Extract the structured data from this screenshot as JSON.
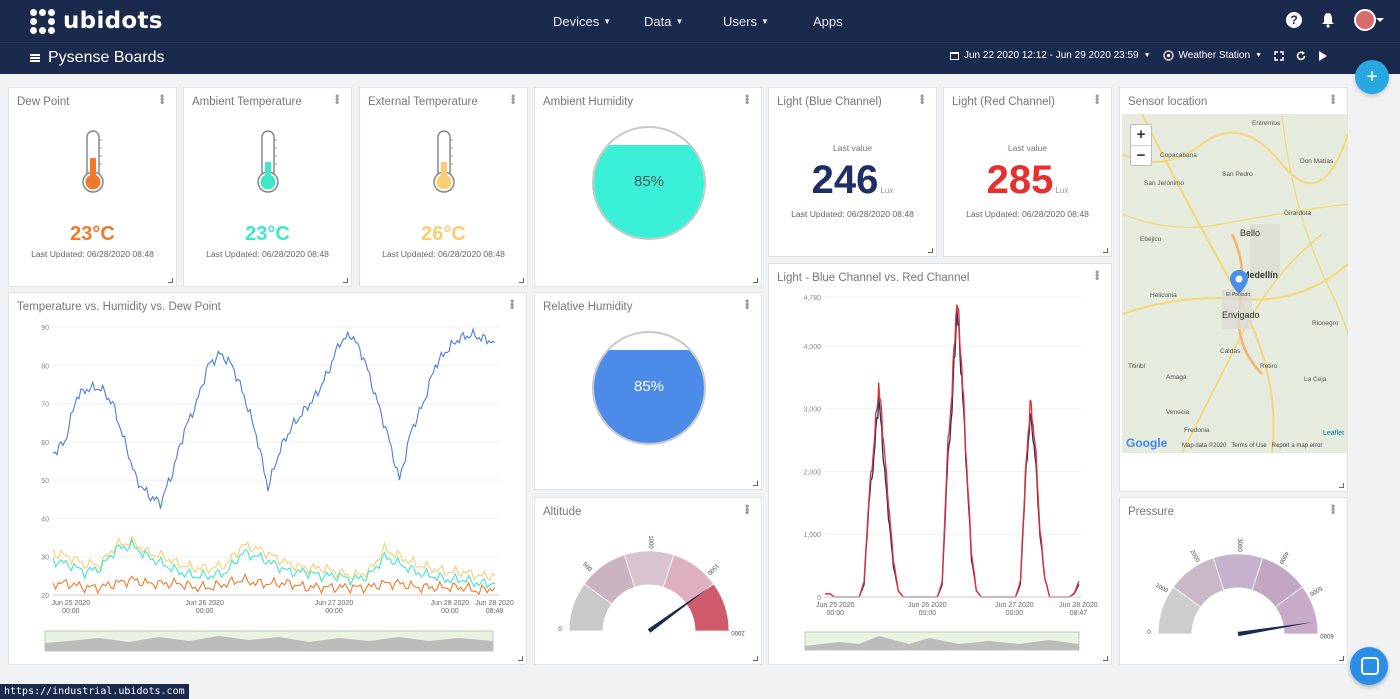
{
  "app": {
    "brand": "ubidots"
  },
  "nav": [
    {
      "label": "Devices",
      "caret": true
    },
    {
      "label": "Data",
      "caret": true
    },
    {
      "label": "Users",
      "caret": true
    },
    {
      "label": "Apps",
      "caret": false
    }
  ],
  "top_icons": [
    "help-icon",
    "bell-icon",
    "avatar"
  ],
  "board": {
    "title": "Pysense Boards"
  },
  "controls": {
    "date_range": "Jun 22 2020 12:12 - Jun 29 2020 23:59",
    "device": "Weather Station"
  },
  "fab_label": "+",
  "widgets": {
    "dew_point": {
      "title": "Dew Point",
      "value": "23°C",
      "updated": "Last Updated: 06/28/2020 08:48",
      "color": "#f07a2b",
      "level": 0.55
    },
    "ambient_temp": {
      "title": "Ambient Temperature",
      "value": "23°C",
      "updated": "Last Updated: 06/28/2020 08:48",
      "color": "#3fe6c8",
      "level": 0.3
    },
    "external_temp": {
      "title": "External Temperature",
      "value": "26°C",
      "updated": "Last Updated: 06/28/2020 08:48",
      "color": "#f9cd74",
      "level": 0.3
    },
    "ambient_humidity": {
      "title": "Ambient Humidity",
      "value": "85%",
      "level": 0.85,
      "color": "#3af0d6"
    },
    "relative_humidity": {
      "title": "Relative Humidity",
      "value": "85%",
      "level": 0.85,
      "color": "#4c8be8"
    },
    "light_blue": {
      "title": "Light (Blue Channel)",
      "label": "Last value",
      "value": "246",
      "unit": "Lux",
      "updated": "Last Updated: 06/28/2020 08:48",
      "color": "#1e2f66"
    },
    "light_red": {
      "title": "Light (Red Channel)",
      "label": "Last value",
      "value": "285",
      "unit": "Lux",
      "updated": "Last Updated: 06/28/2020 08:48",
      "color": "#e82f2f"
    },
    "sensor_location": {
      "title": "Sensor location",
      "zoom_in": "+",
      "zoom_out": "−",
      "places": [
        "Entrerrios",
        "Copacabana",
        "San Jerónimo",
        "San Pedro",
        "Don Matías",
        "Girardota",
        "Ebéjico",
        "Bello",
        "Medellín",
        "Heliconia",
        "Envigado",
        "Rionegro",
        "Caldas",
        "Amagá",
        "Retiro",
        "Titiribí",
        "La Ceja",
        "Venecia",
        "Fredonia",
        "El Poblado"
      ],
      "attribution": "Map data ©2020   Terms of Use   Report a map error",
      "google": "Google",
      "leaflet": "Leaflet"
    },
    "temp_chart": {
      "title": "Temperature vs. Humidity vs. Dew Point"
    },
    "light_chart": {
      "title": "Light - Blue Channel vs. Red Channel"
    },
    "altitude": {
      "title": "Altitude",
      "min": 0,
      "max": 2000,
      "ticks": [
        "0",
        "500",
        "1000",
        "1500",
        "2000"
      ],
      "value": 1600
    },
    "pressure": {
      "title": "Pressure",
      "min": 0,
      "max": 6000,
      "ticks": [
        "0",
        "1000",
        "2000",
        "3000",
        "4000",
        "5000",
        "6000"
      ],
      "value": 5700
    }
  },
  "chart_data": [
    {
      "type": "line",
      "name": "temp_chart",
      "x_ticks": [
        "Jun 25 2020\n00:00",
        "Jun 26 2020\n00:00",
        "Jun 27 2020\n00:00",
        "Jun 28 2020\n00:00",
        "Jun 28 2020\n08:48"
      ],
      "ylim": [
        20,
        90
      ],
      "y_ticks": [
        20,
        30,
        40,
        50,
        60,
        70,
        80,
        90
      ],
      "series": [
        {
          "color": "#4a7fd6",
          "values": [
            57,
            60,
            72,
            74,
            74,
            70,
            60,
            50,
            46,
            44,
            52,
            63,
            70,
            80,
            83,
            80,
            72,
            62,
            48,
            58,
            64,
            68,
            72,
            78,
            86,
            88,
            82,
            72,
            62,
            50,
            63,
            70,
            80,
            84,
            87,
            88,
            87,
            86
          ]
        },
        {
          "color": "#f9cd74",
          "values": [
            31,
            30,
            28,
            28,
            33,
            34,
            31,
            30,
            28,
            27,
            27,
            28,
            33,
            32,
            30,
            28,
            27,
            27,
            26,
            25,
            26,
            32,
            30,
            28,
            27,
            26,
            26,
            25,
            25
          ]
        },
        {
          "color": "#3fe6c8",
          "values": [
            29,
            28,
            26,
            27,
            32,
            33,
            30,
            28,
            26,
            25,
            25,
            26,
            31,
            30,
            28,
            26,
            26,
            25,
            25,
            24,
            25,
            30,
            28,
            26,
            25,
            24,
            24,
            23,
            23
          ]
        },
        {
          "color": "#f07a2b",
          "values": [
            23,
            23,
            22,
            22,
            23,
            24,
            23,
            23,
            23,
            22,
            22,
            23,
            24,
            23,
            23,
            23,
            22,
            22,
            22,
            22,
            22,
            23,
            23,
            22,
            22,
            22,
            22,
            21,
            22
          ]
        }
      ]
    },
    {
      "type": "line",
      "name": "light_chart",
      "x_ticks": [
        "Jun 25 2020\n00:00",
        "Jun 26 2020\n00:00",
        "Jun 27 2020\n00:00",
        "Jun 28 2020\n08:47"
      ],
      "ylim": [
        0,
        4780
      ],
      "y_ticks": [
        0,
        1000,
        2000,
        3000,
        4000,
        4780
      ],
      "series": [
        {
          "color": "#1e2f66",
          "values": [
            50,
            50,
            0,
            0,
            0,
            0,
            0,
            0,
            200,
            1500,
            2200,
            3200,
            2200,
            1300,
            500,
            100,
            0,
            0,
            0,
            0,
            0,
            0,
            0,
            0,
            200,
            2000,
            3000,
            4600,
            3500,
            2000,
            600,
            100,
            0,
            0,
            0,
            0,
            0,
            0,
            0,
            0,
            200,
            1800,
            2900,
            2300,
            1000,
            300,
            0,
            0,
            0,
            0,
            0,
            50,
            200
          ]
        },
        {
          "color": "#e82f2f",
          "values": [
            50,
            50,
            0,
            0,
            0,
            0,
            0,
            0,
            250,
            1600,
            2400,
            3400,
            2500,
            1500,
            600,
            100,
            0,
            0,
            0,
            0,
            0,
            0,
            0,
            0,
            250,
            2200,
            3300,
            4780,
            3700,
            2100,
            700,
            100,
            0,
            0,
            0,
            0,
            0,
            0,
            0,
            0,
            250,
            1900,
            3100,
            2500,
            1100,
            300,
            0,
            0,
            0,
            0,
            0,
            60,
            250
          ]
        }
      ]
    }
  ],
  "status_url": "https://industrial.ubidots.com"
}
